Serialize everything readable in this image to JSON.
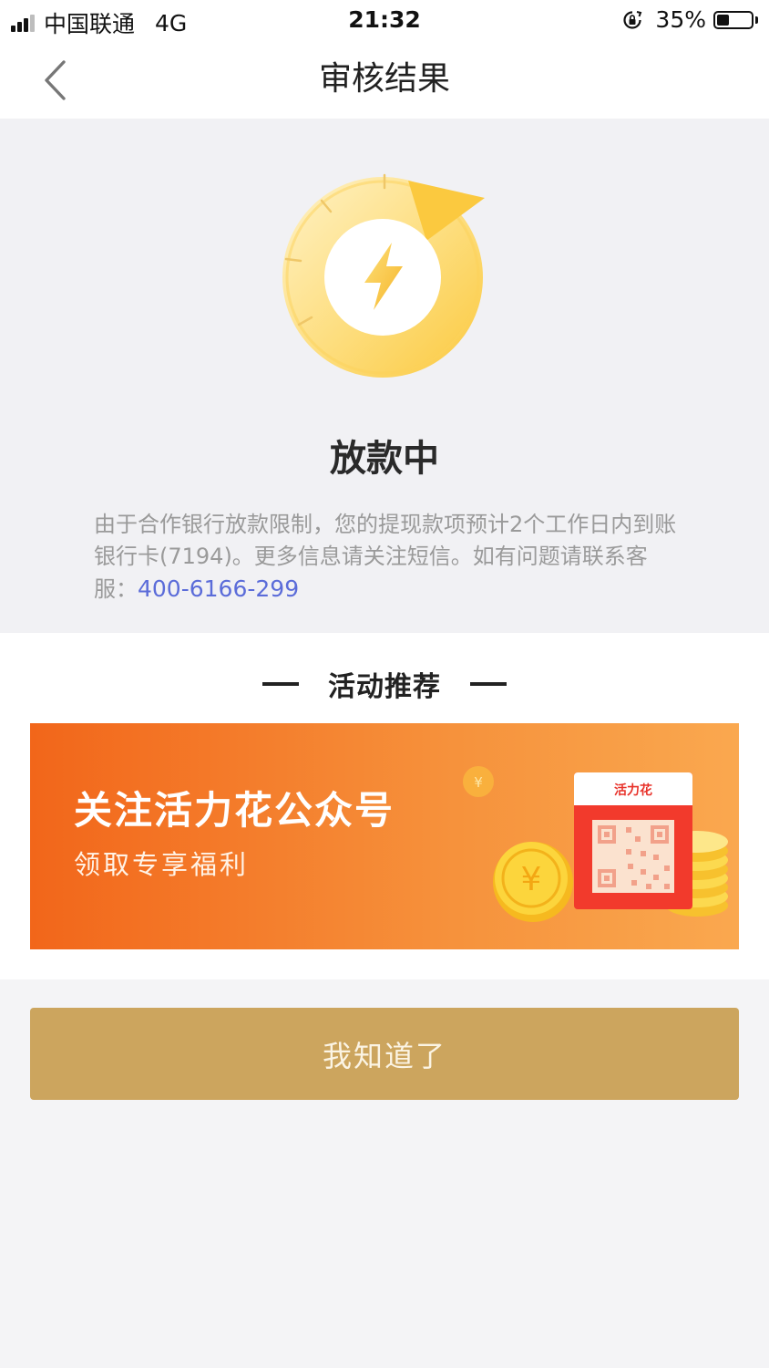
{
  "status_bar": {
    "carrier": "中国联通",
    "network": "4G",
    "time": "21:32",
    "battery_percent_label": "35%",
    "battery_level": 0.35
  },
  "nav": {
    "title": "审核结果"
  },
  "status": {
    "title": "放款中",
    "description": "由于合作银行放款限制，您的提现款项预计2个工作日内到账银行卡(7194)。更多信息请关注短信。如有问题请联系客服：",
    "phone": "400-6166-299"
  },
  "activity": {
    "section_title": "活动推荐",
    "banner": {
      "title": "关注活力花公众号",
      "subtitle": "领取专享福利",
      "card_label": "活力花",
      "coin_symbol": "¥"
    }
  },
  "confirm": {
    "label": "我知道了"
  },
  "colors": {
    "accent_gold": "#cca55e",
    "link_blue": "#5b6cd9",
    "banner_orange": "#f2661a",
    "icon_yellow": "#fbc93f"
  }
}
